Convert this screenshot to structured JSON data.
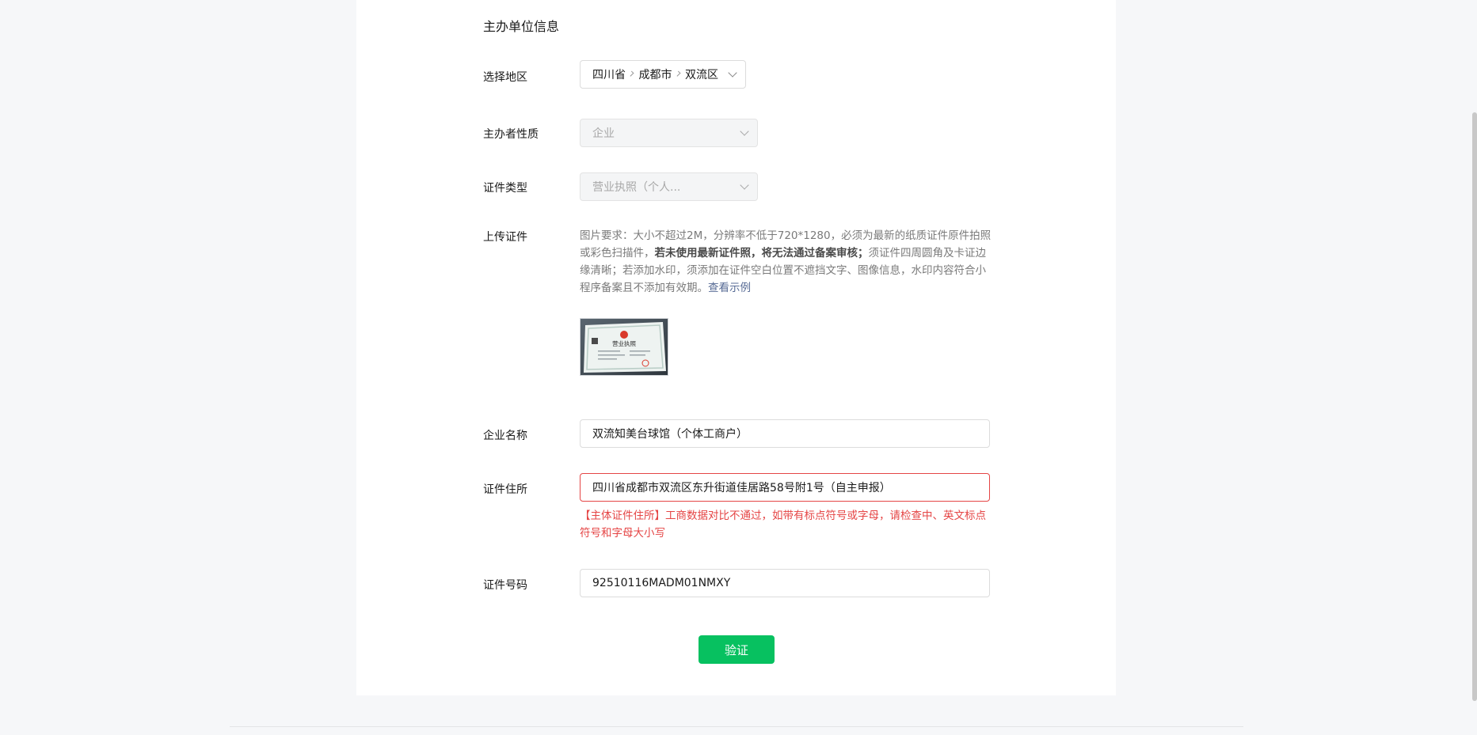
{
  "section": {
    "title": "主办单位信息"
  },
  "region": {
    "label": "选择地区",
    "province": "四川省",
    "city": "成都市",
    "district": "双流区"
  },
  "host_type": {
    "label": "主办者性质",
    "value": "企业"
  },
  "cert_type": {
    "label": "证件类型",
    "value": "营业执照（个人..."
  },
  "upload": {
    "label": "上传证件",
    "desc_part1": "图片要求：大小不超过2M，分辨率不低于720*1280，必须为最新的纸质证件原件拍照或彩色扫描件，",
    "desc_bold": "若未使用最新证件照，将无法通过备案审核；",
    "desc_part2": "须证件四周圆角及卡证边缘清晰；若添加水印，须添加在证件空白位置不遮挡文字、图像信息，水印内容符合小程序备案且不添加有效期。",
    "example_link": "查看示例",
    "thumb_text": "营业执照"
  },
  "company": {
    "label": "企业名称",
    "value": "双流知美台球馆（个体工商户）"
  },
  "address": {
    "label": "证件住所",
    "value": "四川省成都市双流区东升街道佳居路58号附1号（自主申报）",
    "error": "【主体证件住所】工商数据对比不通过，如带有标点符号或字母，请检查中、英文标点符号和字母大小写"
  },
  "cert_number": {
    "label": "证件号码",
    "value": "92510116MADM01NMXY"
  },
  "verify_button": "验证",
  "colors": {
    "primary": "#07c160",
    "error": "#e54545",
    "link": "#576b95"
  }
}
